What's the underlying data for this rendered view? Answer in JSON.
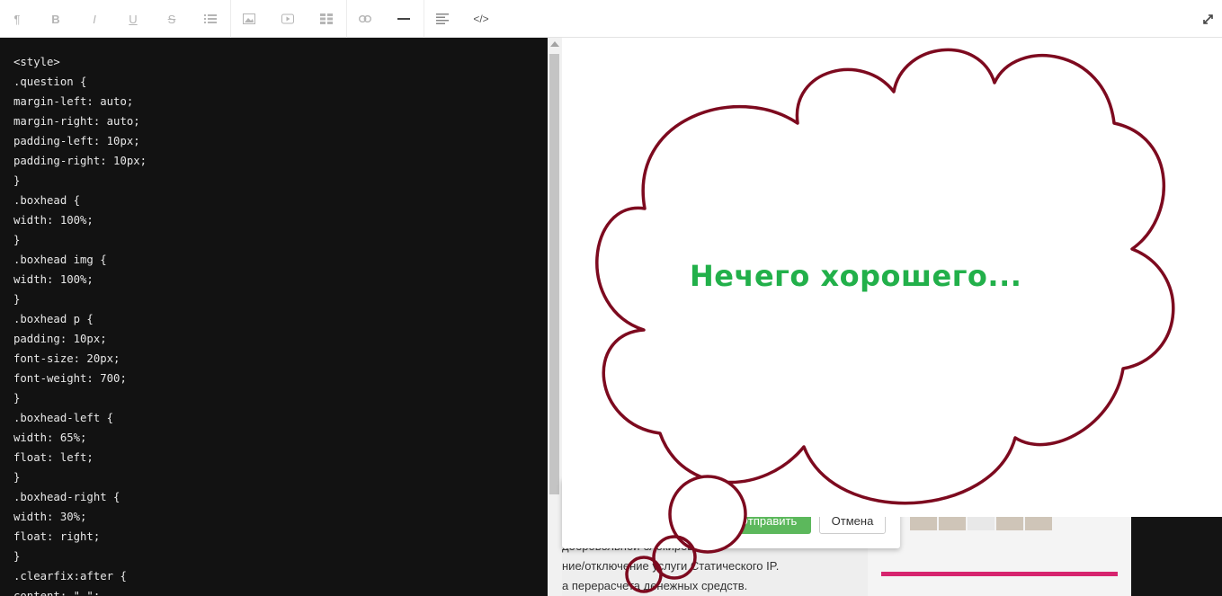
{
  "toolbar": {
    "paragraph": "¶",
    "bold": "B",
    "italic": "I",
    "underline": "U",
    "strike": "S",
    "code_view": "</>",
    "icons": [
      "paragraph-icon",
      "bold-icon",
      "italic-icon",
      "underline-icon",
      "strikethrough-icon",
      "list-icon",
      "image-icon",
      "video-icon",
      "table-icon",
      "link-icon",
      "horizontal-rule-icon",
      "align-icon",
      "code-icon",
      "fullscreen-icon"
    ]
  },
  "editor": {
    "lines": [
      "<style>",
      ".question {",
      "margin-left: auto;",
      "margin-right: auto;",
      "padding-left: 10px;",
      "padding-right: 10px;",
      "}",
      ".boxhead {",
      "width: 100%;",
      "}",
      ".boxhead img {",
      "width: 100%;",
      "}",
      ".boxhead p {",
      "padding: 10px;",
      "font-size: 20px;",
      "font-weight: 700;",
      "}",
      ".boxhead-left {",
      "width: 65%;",
      "float: left;",
      "}",
      ".boxhead-right {",
      "width: 30%;",
      "float: right;",
      "}",
      ".clearfix:after {",
      "content: \" \";"
    ]
  },
  "preview": {
    "cloud_text": "Нечего хорошего...",
    "send_button": "Отправить",
    "cancel_button": "Отмена",
    "underlying_lines": [
      "добровольной блокировки.",
      "ние/отключение услуги Статического IP.",
      "а перерасчета денежных средств."
    ],
    "colors": {
      "cloud_stroke": "#7d0a1f",
      "cloud_text": "#22b04a",
      "send": "#5cb85c",
      "pink_bar": "#d6246e"
    }
  }
}
